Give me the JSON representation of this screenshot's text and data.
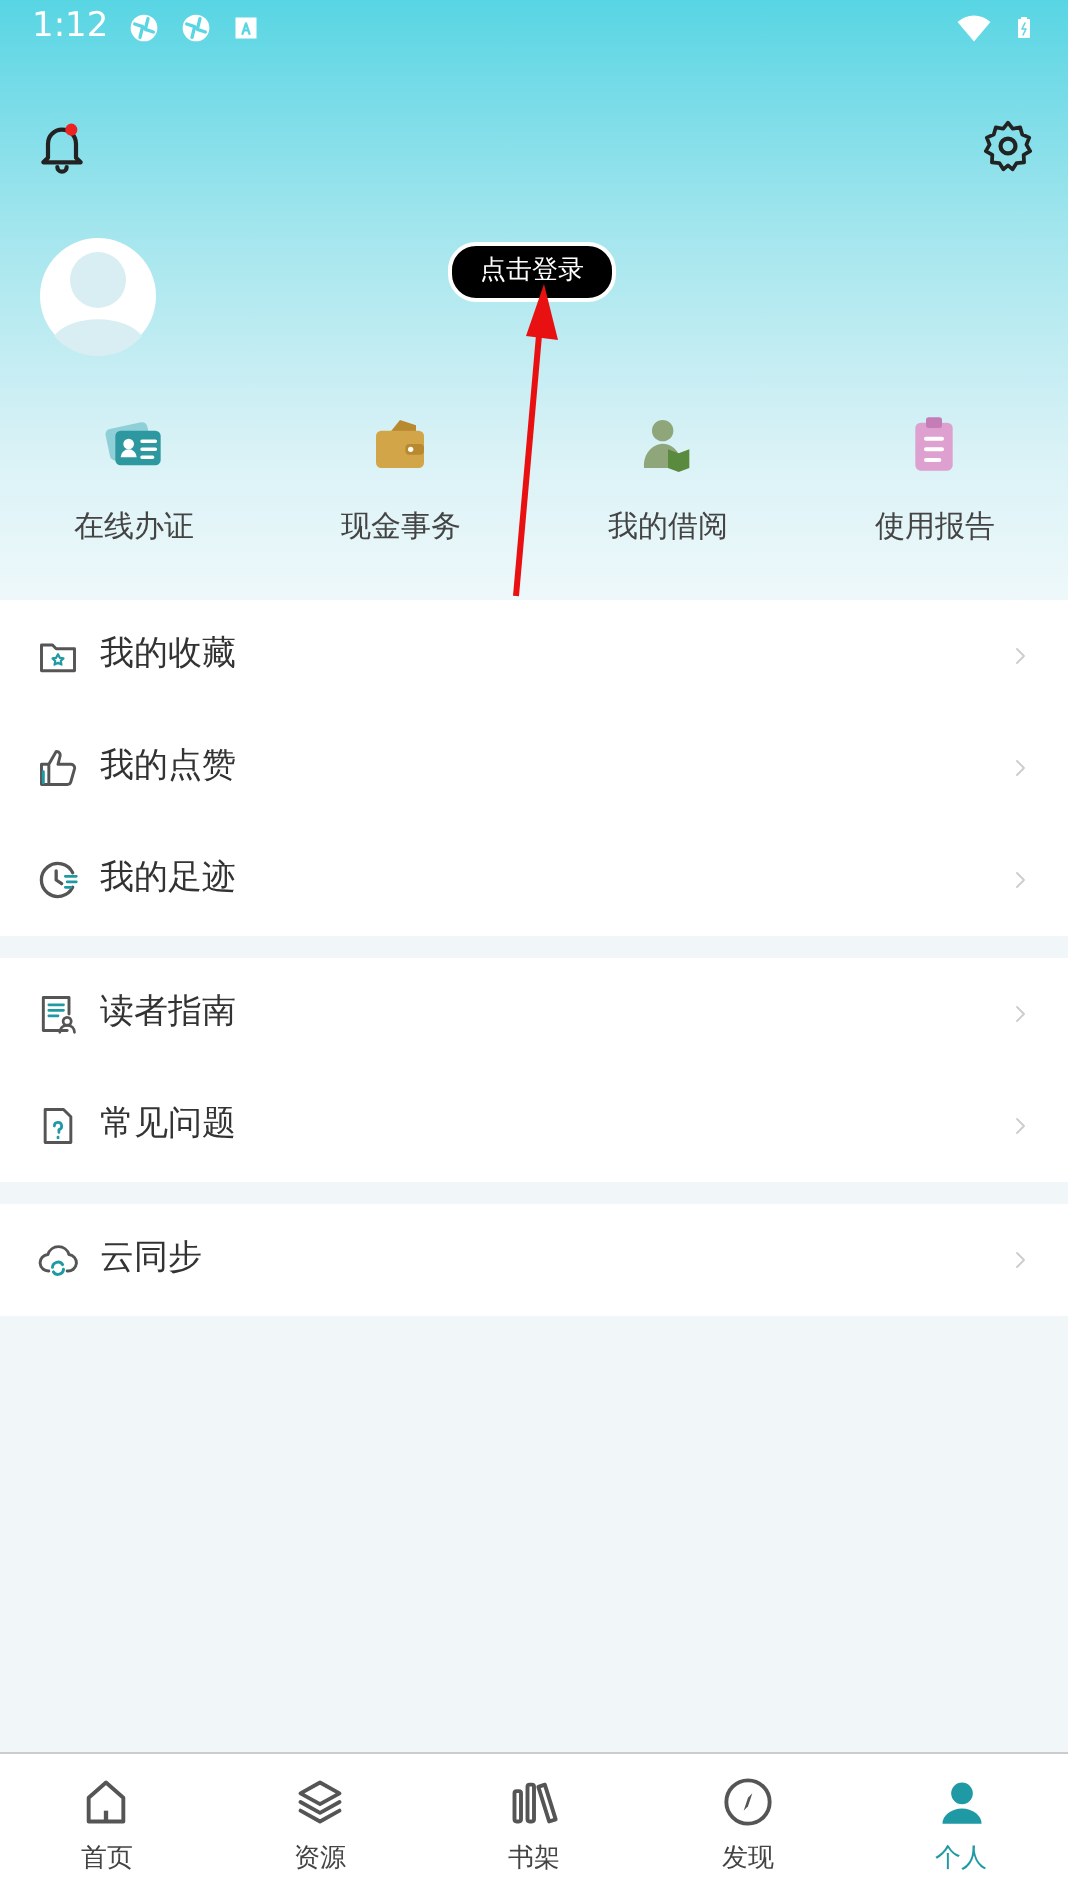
{
  "status_bar": {
    "time": "1:12"
  },
  "header": {
    "login_label": "点击登录",
    "has_notification": true
  },
  "shortcuts": [
    {
      "label": "在线办证"
    },
    {
      "label": "现金事务"
    },
    {
      "label": "我的借阅"
    },
    {
      "label": "使用报告"
    }
  ],
  "menu_groups": [
    {
      "items": [
        {
          "label": "我的收藏"
        },
        {
          "label": "我的点赞"
        },
        {
          "label": "我的足迹"
        }
      ]
    },
    {
      "items": [
        {
          "label": "读者指南"
        },
        {
          "label": "常见问题"
        }
      ]
    },
    {
      "items": [
        {
          "label": "云同步"
        }
      ]
    }
  ],
  "bottom_nav": [
    {
      "label": "首页",
      "selected": false
    },
    {
      "label": "资源",
      "selected": false
    },
    {
      "label": "书架",
      "selected": false
    },
    {
      "label": "发现",
      "selected": false
    },
    {
      "label": "个人",
      "selected": true
    }
  ]
}
